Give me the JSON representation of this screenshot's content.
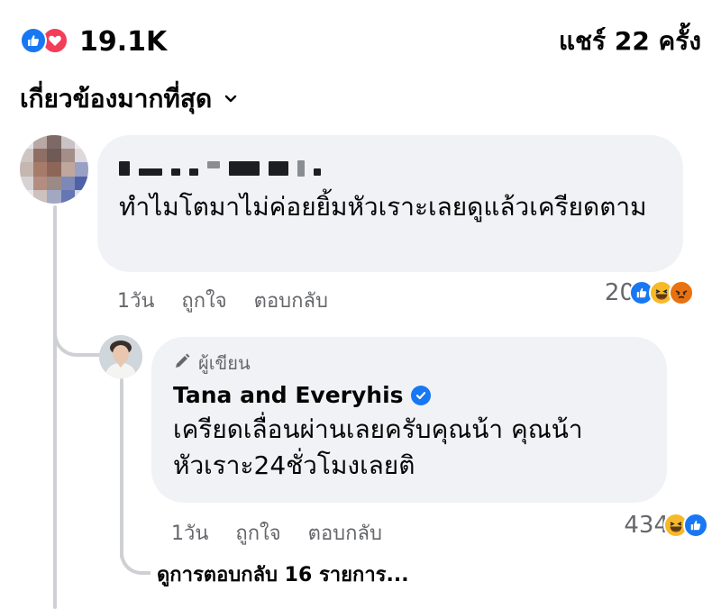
{
  "post_stats": {
    "reaction_count": "19.1K",
    "reaction_icons": [
      "like-icon",
      "love-icon"
    ],
    "shares": "แชร์ 22 ครั้ง"
  },
  "sort": {
    "label": "เกี่ยวข้องมากที่สุด",
    "icon": "chevron-down-icon"
  },
  "comment": {
    "author_redacted": true,
    "text": "ทำไมโตมาไม่ค่อยยิ้มหัวเราะเลยดูแล้วเครียดตาม",
    "time": "1วัน",
    "like_label": "ถูกใจ",
    "reply_label": "ตอบกลับ",
    "reaction_count": "20",
    "reaction_icons": [
      "like-icon",
      "haha-icon",
      "angry-icon"
    ]
  },
  "reply": {
    "badge": "ผู้เขียน",
    "author": "Tana and Everyhis",
    "verified": true,
    "text": "เครียดเลื่อนผ่านเลยครับคุณน้า  คุณน้าหัวเราะ24ชั่วโมงเลยติ",
    "time": "1วัน",
    "like_label": "ถูกใจ",
    "reply_label": "ตอบกลับ",
    "reaction_count": "434",
    "reaction_icons": [
      "haha-icon",
      "like-icon"
    ]
  },
  "view_more": "ดูการตอบกลับ 16 รายการ...",
  "colors": {
    "facebook_blue": "#1877f2",
    "love_red": "#f33e58",
    "bubble_bg": "#f0f2f5",
    "secondary_text": "#65676b"
  }
}
